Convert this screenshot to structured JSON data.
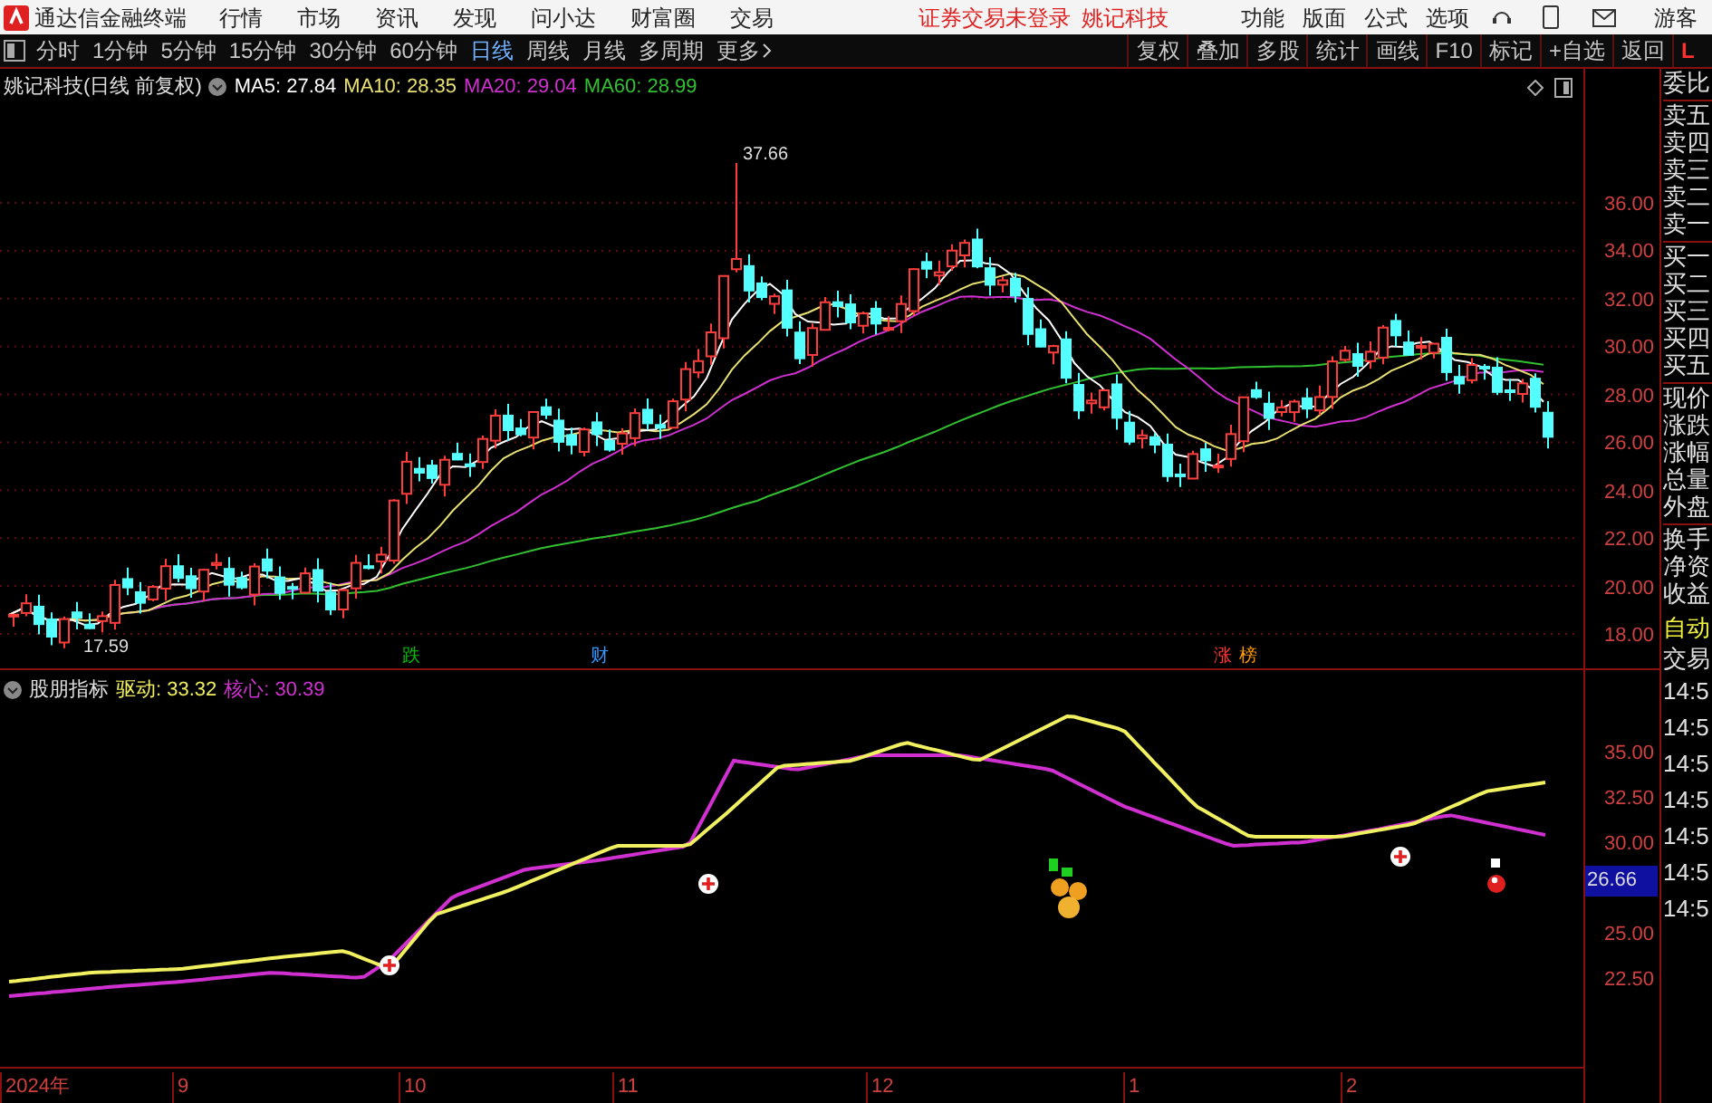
{
  "app_bar": {
    "app_title": "通达信金融终端",
    "menus": [
      "行情",
      "市场",
      "资讯",
      "发现",
      "问小达",
      "财富圈",
      "交易"
    ],
    "notice": "证券交易未登录",
    "stock": "姚记科技",
    "right_menus": [
      "功能",
      "版面",
      "公式",
      "选项"
    ],
    "user": "游客"
  },
  "period_toolbar": {
    "periods": [
      {
        "label": "分时",
        "selected": false
      },
      {
        "label": "1分钟",
        "selected": false
      },
      {
        "label": "5分钟",
        "selected": false
      },
      {
        "label": "15分钟",
        "selected": false
      },
      {
        "label": "30分钟",
        "selected": false
      },
      {
        "label": "60分钟",
        "selected": false
      },
      {
        "label": "日线",
        "selected": true
      },
      {
        "label": "周线",
        "selected": false
      },
      {
        "label": "月线",
        "selected": false
      },
      {
        "label": "多周期",
        "selected": false
      }
    ],
    "more": "更多",
    "tools": [
      "复权",
      "叠加",
      "多股",
      "统计",
      "画线",
      "F10",
      "标记",
      "+自选",
      "返回"
    ],
    "corner": "L"
  },
  "main_chart": {
    "title": "姚记科技(日线 前复权)",
    "ma": [
      {
        "label": "MA5: 27.84",
        "color": "#ffffff"
      },
      {
        "label": "MA10: 28.35",
        "color": "#e8e070"
      },
      {
        "label": "MA20: 29.04",
        "color": "#d030d0"
      },
      {
        "label": "MA60: 28.99",
        "color": "#30c030"
      }
    ],
    "high_label": "37.66",
    "low_label": "17.59",
    "price_ticks": [
      "36.00",
      "34.00",
      "32.00",
      "30.00",
      "28.00",
      "26.00",
      "24.00",
      "22.00",
      "20.00",
      "18.00"
    ],
    "event_marks": [
      {
        "text": "跌",
        "color": "#00c000"
      },
      {
        "text": "财",
        "color": "#3399ff"
      },
      {
        "text": "涨",
        "color": "#ff3333"
      },
      {
        "text": "榜",
        "color": "#ff9900"
      }
    ]
  },
  "indicator": {
    "name": "股朋指标",
    "series": [
      {
        "label": "驱动: 33.32",
        "color": "#f0f060"
      },
      {
        "label": "核心: 30.39",
        "color": "#d030d0"
      }
    ],
    "ticks": [
      "35.00",
      "32.50",
      "30.00",
      "25.00",
      "22.50"
    ],
    "current": "26.66"
  },
  "date_axis": [
    "2024年",
    "9",
    "10",
    "11",
    "12",
    "1",
    "2"
  ],
  "quote_panel": {
    "labels": [
      "委比",
      "卖五",
      "卖四",
      "卖三",
      "卖二",
      "卖一",
      "买一",
      "买二",
      "买三",
      "买四",
      "买五",
      "现价",
      "涨跌",
      "涨幅",
      "总量",
      "外盘",
      "换手",
      "净资",
      "收益"
    ],
    "auto": "自动",
    "trade": "交易",
    "times": [
      "14:5",
      "14:5",
      "14:5",
      "14:5",
      "14:5",
      "14:5",
      "14:5"
    ]
  }
}
